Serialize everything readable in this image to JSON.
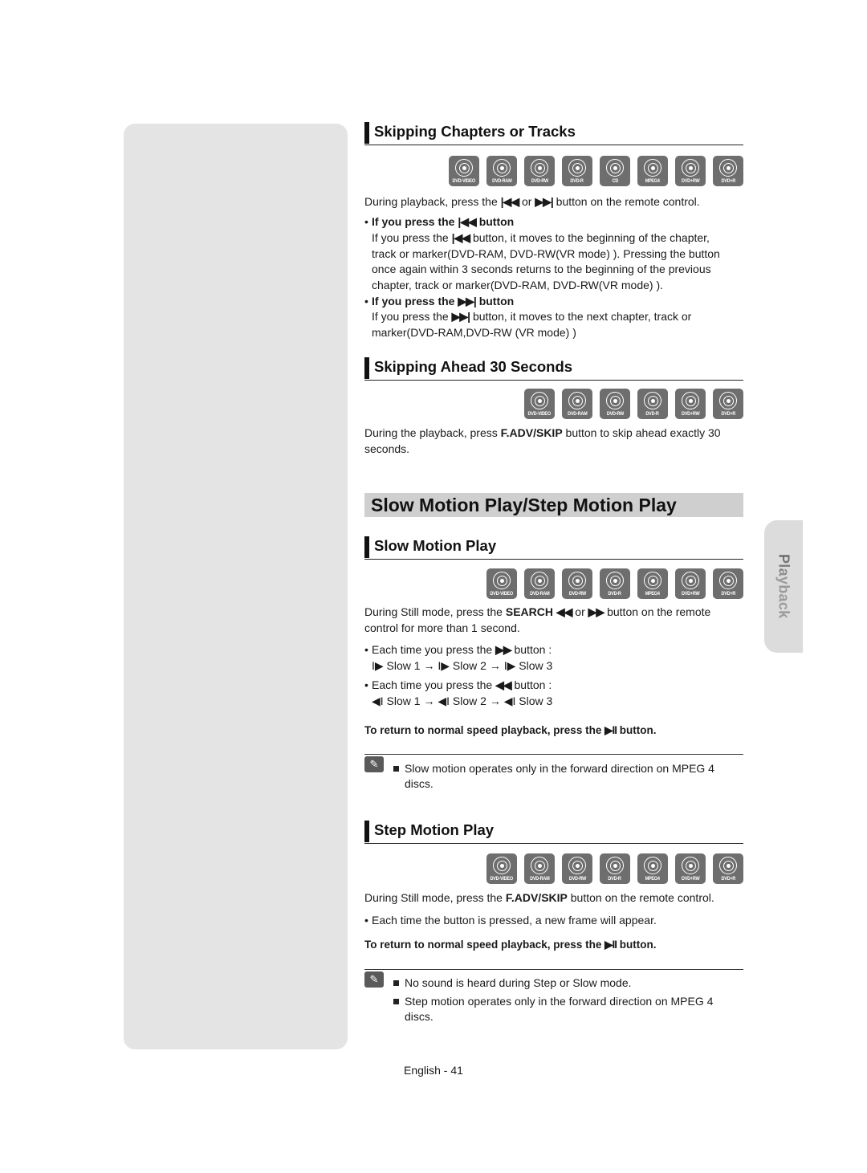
{
  "side_tab": {
    "label": "Playback"
  },
  "disc_types": {
    "dvd_video": "DVD-VIDEO",
    "dvd_ram": "DVD-RAM",
    "dvd_rw": "DVD-RW",
    "dvd_r": "DVD-R",
    "cd": "CD",
    "mpeg4": "MPEG4",
    "dvd_plus_rw": "DVD+RW",
    "dvd_plus_r": "DVD+R"
  },
  "skip_chapters": {
    "heading": "Skipping Chapters or Tracks",
    "discs": [
      "DVD-VIDEO",
      "DVD-RAM",
      "DVD-RW",
      "DVD-R",
      "CD",
      "MPEG4",
      "DVD+RW",
      "DVD+R"
    ],
    "intro": {
      "before": "During playback, press the ",
      "sym1": "|◀◀",
      "mid": " or ",
      "sym2": "▶▶|",
      "after": " button on the remote control."
    },
    "prev": {
      "title_before": "If you press the ",
      "title_sym": "|◀◀",
      "title_after": " button",
      "line1_before": "If you press the ",
      "line1_sym": "|◀◀",
      "line1_after": " button, it moves to the beginning of the chapter,",
      "line2": "track or marker(DVD-RAM, DVD-RW(VR mode) ). Pressing the button",
      "line3": "once again within 3 seconds returns to the beginning of the previous",
      "line4": "chapter, track or marker(DVD-RAM, DVD-RW(VR mode) )."
    },
    "next": {
      "title_before": "If you press the ",
      "title_sym": "▶▶|",
      "title_after": " button",
      "line1_before": "If you press the ",
      "line1_sym": "▶▶|",
      "line1_after": " button, it moves to the next chapter, track or",
      "line2": "marker(DVD-RAM,DVD-RW (VR mode) )"
    }
  },
  "skip_ahead": {
    "heading": "Skipping Ahead 30 Seconds",
    "discs": [
      "DVD-VIDEO",
      "DVD-RAM",
      "DVD-RW",
      "DVD-R",
      "DVD+RW",
      "DVD+R"
    ],
    "text_before": "During the playback, press ",
    "text_bold": "F.ADV/SKIP",
    "text_after": " button to skip ahead exactly 30",
    "text_line2": "seconds."
  },
  "main_title": "Slow Motion Play/Step Motion Play",
  "slow_motion": {
    "heading": "Slow Motion Play",
    "discs": [
      "DVD-VIDEO",
      "DVD-RAM",
      "DVD-RW",
      "DVD-R",
      "MPEG4",
      "DVD+RW",
      "DVD+R"
    ],
    "intro_before": "During Still mode, press the ",
    "intro_bold": "SEARCH",
    "intro_sym1": "◀◀",
    "intro_mid": " or ",
    "intro_sym2": "▶▶",
    "intro_after": " button on the remote",
    "intro_line2": "control for more than 1 second.",
    "fwd_before": "Each time you press the ",
    "fwd_sym": "▶▶",
    "fwd_after": " button :",
    "fwd_seq": [
      "I▶ Slow 1",
      "I▶ Slow 2",
      "I▶ Slow 3"
    ],
    "rev_before": "Each time you press the ",
    "rev_sym": "◀◀",
    "rev_after": " button :",
    "rev_seq": [
      "◀I Slow 1",
      "◀I Slow 2",
      "◀I Slow 3"
    ],
    "arrow": "→",
    "return_before": "To return to normal speed playback, press the ",
    "return_sym": "▶II",
    "return_after": " button.",
    "notes": [
      "Slow motion operates only in the forward direction on MPEG 4 discs."
    ]
  },
  "step_motion": {
    "heading": "Step Motion Play",
    "discs": [
      "DVD-VIDEO",
      "DVD-RAM",
      "DVD-RW",
      "DVD-R",
      "MPEG4",
      "DVD+RW",
      "DVD+R"
    ],
    "intro_before": "During Still mode, press the ",
    "intro_bold": "F.ADV/SKIP",
    "intro_after": " button on the remote control.",
    "bullet": "Each time the button is pressed, a new frame will appear.",
    "return_before": "To return to normal speed playback, press the ",
    "return_sym": "▶II",
    "return_after": " button.",
    "notes": [
      "No sound is heard during Step or Slow mode.",
      "Step motion operates only in the forward direction on MPEG 4 discs."
    ]
  },
  "footer": {
    "page_label": "English - 41"
  },
  "bullet_char": "•",
  "note_icon_glyph": "✎"
}
